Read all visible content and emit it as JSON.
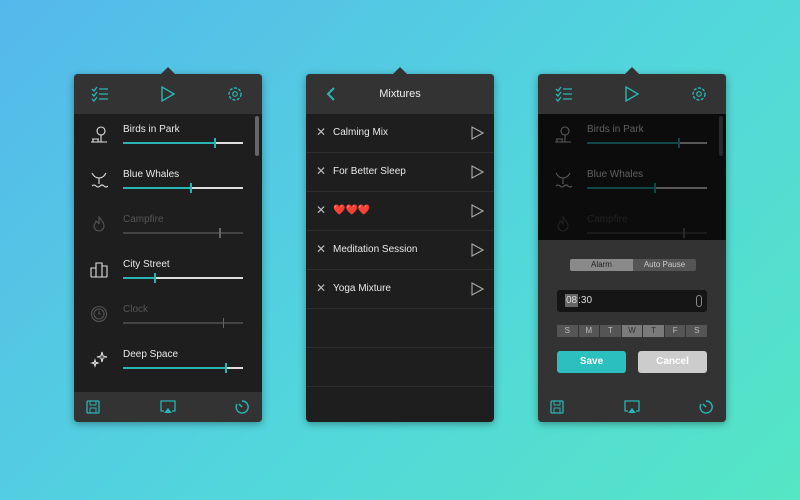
{
  "colors": {
    "accent": "#2ab5b5",
    "panel": "#1e1e1e",
    "header": "#333333"
  },
  "sounds": [
    {
      "label": "Birds in Park",
      "volume": 0.76,
      "enabled": true,
      "icon": "tree-bench-icon"
    },
    {
      "label": "Blue Whales",
      "volume": 0.56,
      "enabled": true,
      "icon": "whale-tail-icon"
    },
    {
      "label": "Campfire",
      "volume": 0.8,
      "enabled": false,
      "icon": "campfire-icon"
    },
    {
      "label": "City Street",
      "volume": 0.26,
      "enabled": true,
      "icon": "buildings-icon"
    },
    {
      "label": "Clock",
      "volume": 0.83,
      "enabled": false,
      "icon": "clock-icon"
    },
    {
      "label": "Deep Space",
      "volume": 0.85,
      "enabled": true,
      "icon": "sparkles-icon"
    }
  ],
  "mixtures": {
    "title": "Mixtures",
    "items": [
      {
        "name": "Calming Mix"
      },
      {
        "name": "For Better Sleep"
      },
      {
        "name": "❤️❤️❤️"
      },
      {
        "name": "Meditation Session"
      },
      {
        "name": "Yoga Mixture"
      }
    ]
  },
  "timer": {
    "modes": [
      "Alarm",
      "Auto Pause"
    ],
    "selected_mode": "Alarm",
    "hour": "08",
    "minute": ":30",
    "days": [
      {
        "d": "S",
        "on": false
      },
      {
        "d": "M",
        "on": false
      },
      {
        "d": "T",
        "on": false
      },
      {
        "d": "W",
        "on": true
      },
      {
        "d": "T",
        "on": true
      },
      {
        "d": "F",
        "on": false
      },
      {
        "d": "S",
        "on": false
      }
    ],
    "save": "Save",
    "cancel": "Cancel"
  }
}
